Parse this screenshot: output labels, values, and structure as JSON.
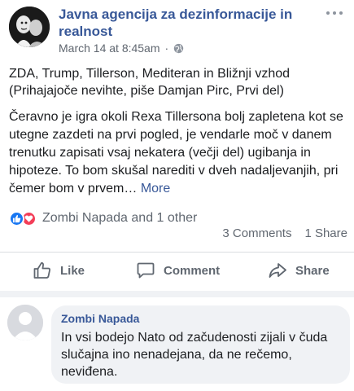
{
  "post": {
    "page_name": "Javna agencija za dezinformacije in realnost",
    "timestamp": "March 14 at 8:45am",
    "privacy_icon": "globe-icon",
    "title": "ZDA, Trump, Tillerson, Mediteran in Bližnji vzhod (Prihajajoče nevihte, piše Damjan Pirc, Prvi del)",
    "body": "Čeravno je igra okoli Rexa Tillersona bolj zapletena kot se utegne zazdeti na prvi pogled, je vendarle moč v danem trenutku zapisati vsaj nekatera (večji del) ugibanja in hipoteze. To bom skušal narediti v dveh nadaljevanjih, pri čemer bom v prvem…",
    "more_label": "More"
  },
  "reactions": {
    "types": [
      "like",
      "love"
    ],
    "text": "Zombi Napada and 1 other"
  },
  "stats": {
    "comments": "3 Comments",
    "shares": "1 Share"
  },
  "actions": {
    "like": "Like",
    "comment": "Comment",
    "share": "Share"
  },
  "comment": {
    "author": "Zombi Napada",
    "text": "In vsi bodejo Nato od začudenosti zijali v čuda slučajna ino nenadejana, da ne rečemo, neviđena."
  },
  "colors": {
    "link_blue": "#385898",
    "like_blue": "#1877f2",
    "love_red": "#f33e58",
    "secondary_gray": "#606770",
    "bubble_gray": "#f0f2f5"
  }
}
